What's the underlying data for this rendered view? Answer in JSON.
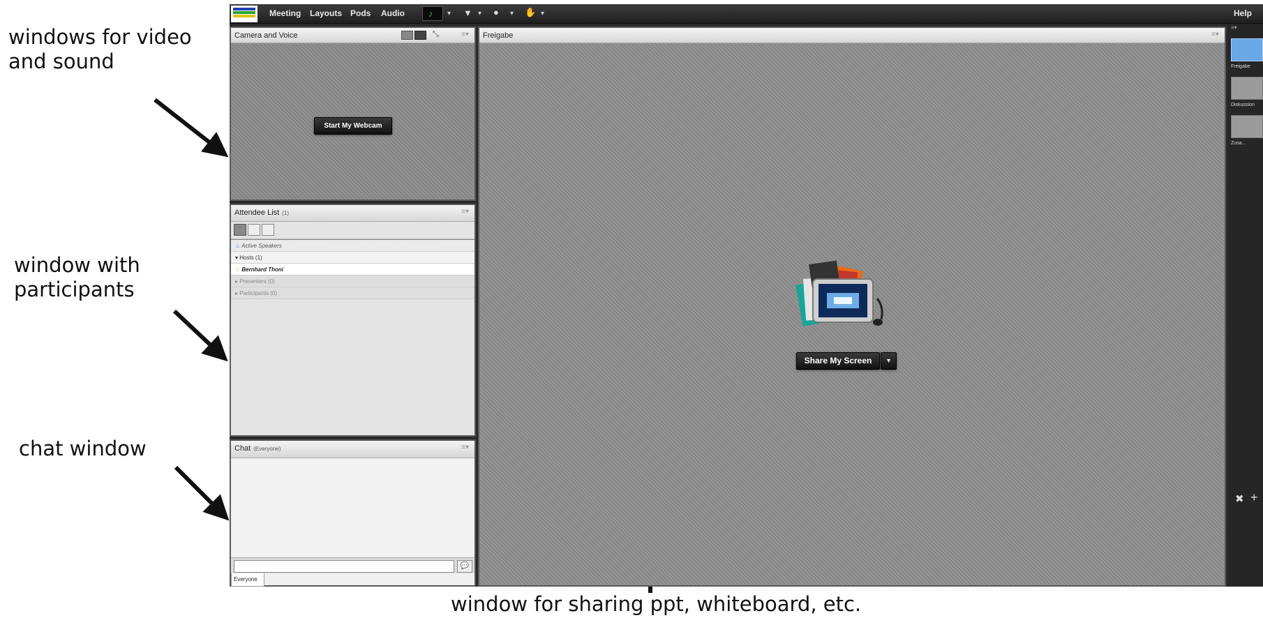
{
  "annotations": {
    "video_sound": [
      "windows for video",
      "and sound"
    ],
    "participants": [
      "window with",
      "participants"
    ],
    "chat": "chat window",
    "sharing": "window for sharing ppt, whiteboard, etc."
  },
  "menubar": {
    "items": [
      "Meeting",
      "Layouts",
      "Pods",
      "Audio"
    ],
    "help": "Help"
  },
  "pods": {
    "camera": {
      "title": "Camera and Voice",
      "start_button": "Start My Webcam"
    },
    "attendee": {
      "title": "Attendee List",
      "count": "(1)",
      "active_speakers": "Active Speakers",
      "hosts": "Hosts (1)",
      "host_name": "Bernhard Thoni",
      "presenters": "Presenters (0)",
      "participants": "Participants (0)"
    },
    "chat": {
      "title": "Chat",
      "scope": "(Everyone)",
      "tab": "Everyone"
    },
    "share": {
      "title": "Freigabe",
      "share_button": "Share My Screen"
    }
  },
  "layouts": [
    {
      "label": "Freigabe",
      "active": true
    },
    {
      "label": "Diskussion",
      "active": false
    },
    {
      "label": "Zusa...",
      "active": false
    }
  ],
  "colors": {
    "speaker_active": "#1f8a1f",
    "layout_active": "#4a90d9"
  }
}
